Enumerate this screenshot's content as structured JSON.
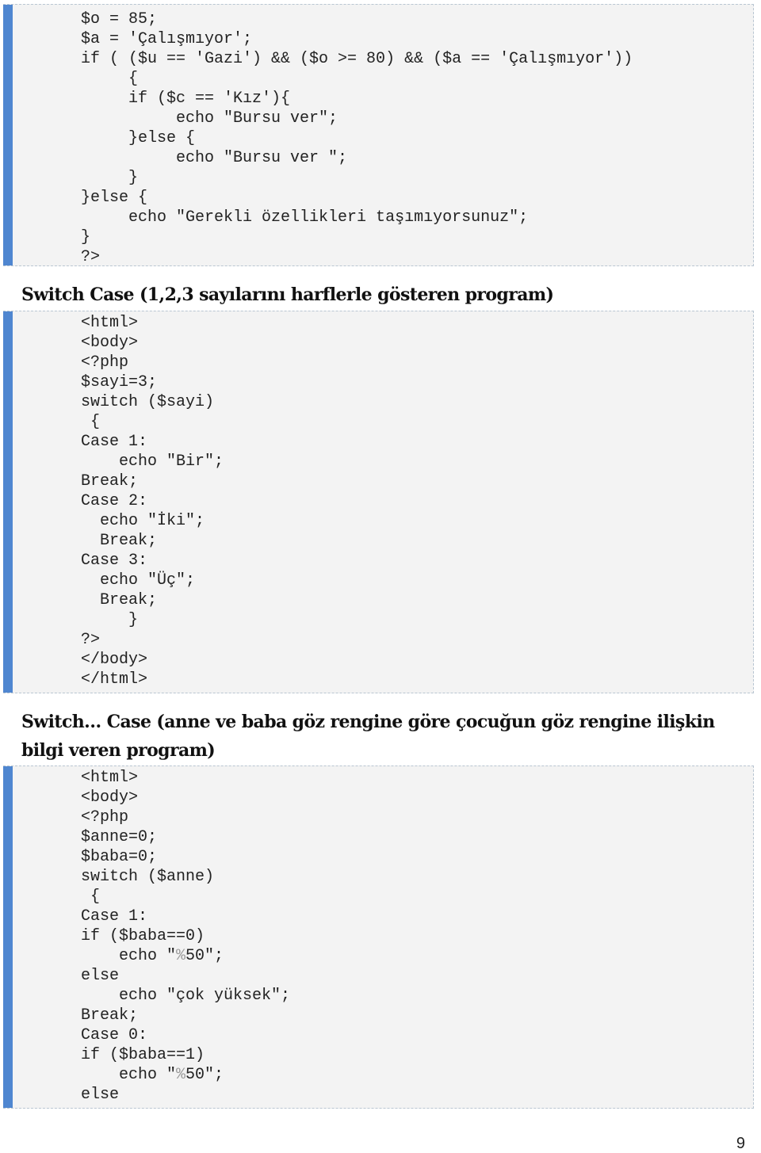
{
  "blocks": [
    {
      "lines": [
        "$o = 85;",
        "$a = 'Çalışmıyor';",
        "if ( ($u == 'Gazi') && ($o >= 80) && ($a == 'Çalışmıyor'))",
        "     {",
        "     if ($c == 'Kız'){",
        "          echo \"Bursu ver\";",
        "     }else {",
        "          echo \"Bursu ver \";",
        "     }",
        "}else {",
        "     echo \"Gerekli özellikleri taşımıyorsunuz\";",
        "}",
        "?>"
      ]
    },
    {
      "lines": [
        "<html>",
        "<body>",
        "<?php",
        "$sayi=3;",
        "switch ($sayi)",
        " {",
        "Case 1:",
        "    echo \"Bir\";",
        "Break;",
        "Case 2:",
        "  echo \"İki\";",
        "  Break;",
        "Case 3:",
        "  echo \"Üç\";",
        "  Break;",
        "     }",
        "?>",
        "</body>",
        "</html>"
      ]
    },
    {
      "lines": [
        "<html>",
        "<body>",
        "<?php",
        "$anne=0;",
        "$baba=0;",
        "switch ($anne)",
        " {",
        "Case 1:",
        "if ($baba==0)",
        "    echo \"%50\";",
        "else",
        "    echo \"çok yüksek\";",
        "Break;",
        "Case 0:",
        "if ($baba==1)",
        "    echo \"%50\";",
        "else"
      ]
    }
  ],
  "headings": {
    "switch_case_numbers": "Switch Case (1,2,3 sayılarını harflerle gösteren program)",
    "switch_case_eye_line1": "Switch… Case (anne ve baba göz rengine göre çocuğun göz rengine ilişkin",
    "switch_case_eye_line2": "bilgi veren program)"
  },
  "page_number": "9",
  "colors": {
    "accent_bar": "#4f86d0",
    "code_background": "#f3f3f3"
  }
}
